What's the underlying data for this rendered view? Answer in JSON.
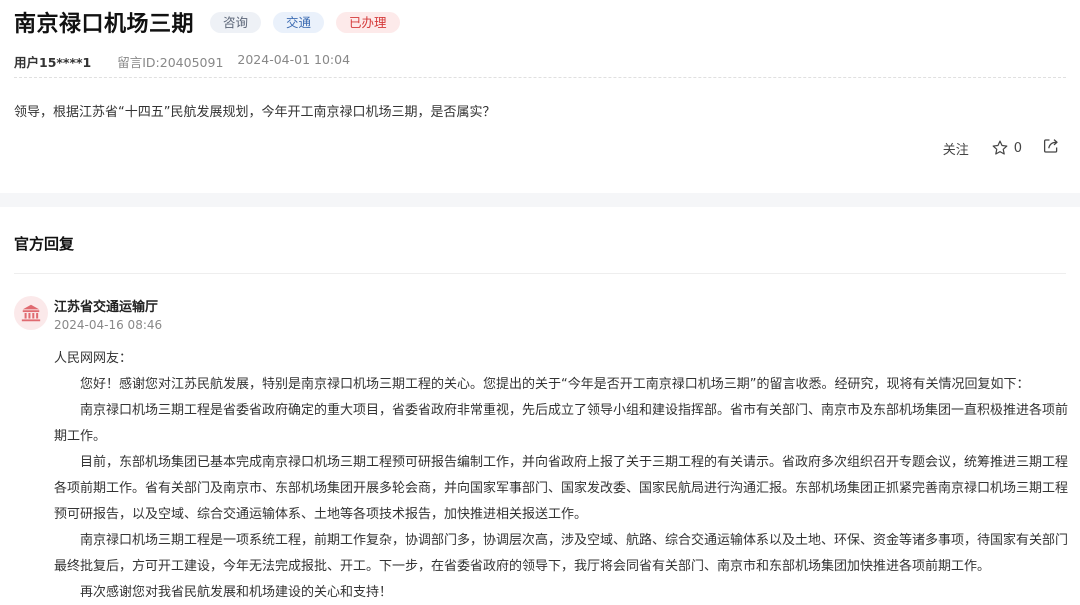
{
  "title": "南京禄口机场三期",
  "tags": [
    "咨询",
    "交通",
    "已办理"
  ],
  "meta": {
    "user": "用户15****1",
    "message_id": "留言ID:20405091",
    "datetime": "2024-04-01 10:04"
  },
  "question": "领导，根据江苏省“十四五”民航发展规划，今年开工南京禄口机场三期，是否属实？",
  "actions": {
    "follow_label": "关注",
    "star_count": "0"
  },
  "official": {
    "heading": "官方回复",
    "department": "江苏省交通运输厅",
    "date": "2024-04-16 08:46",
    "greeting": "人民网网友：",
    "paragraphs": [
      "您好！感谢您对江苏民航发展，特别是南京禄口机场三期工程的关心。您提出的关于“今年是否开工南京禄口机场三期”的留言收悉。经研究，现将有关情况回复如下：",
      "南京禄口机场三期工程是省委省政府确定的重大项目，省委省政府非常重视，先后成立了领导小组和建设指挥部。省市有关部门、南京市及东部机场集团一直积极推进各项前期工作。",
      "目前，东部机场集团已基本完成南京禄口机场三期工程预可研报告编制工作，并向省政府上报了关于三期工程的有关请示。省政府多次组织召开专题会议，统筹推进三期工程各项前期工作。省有关部门及南京市、东部机场集团开展多轮会商，并向国家军事部门、国家发改委、国家民航局进行沟通汇报。东部机场集团正抓紧完善南京禄口机场三期工程预可研报告，以及空域、综合交通运输体系、土地等各项技术报告，加快推进相关报送工作。",
      "南京禄口机场三期工程是一项系统工程，前期工作复杂，协调部门多，协调层次高，涉及空域、航路、综合交通运输体系以及土地、环保、资金等诸多事项，待国家有关部门最终批复后，方可开工建设，今年无法完成报批、开工。下一步，在省委省政府的领导下，我厅将会同省有关部门、南京市和东部机场集团加快推进各项前期工作。",
      "再次感谢您对我省民航发展和机场建设的关心和支持！"
    ]
  },
  "colors": {
    "tag_status": "#d43a3a",
    "tag_traffic": "#3e6db3",
    "avatar_bg": "#fbe9ea",
    "avatar_icon": "#e06a70"
  },
  "icons": [
    "star-icon",
    "share-icon",
    "government-building-icon"
  ]
}
